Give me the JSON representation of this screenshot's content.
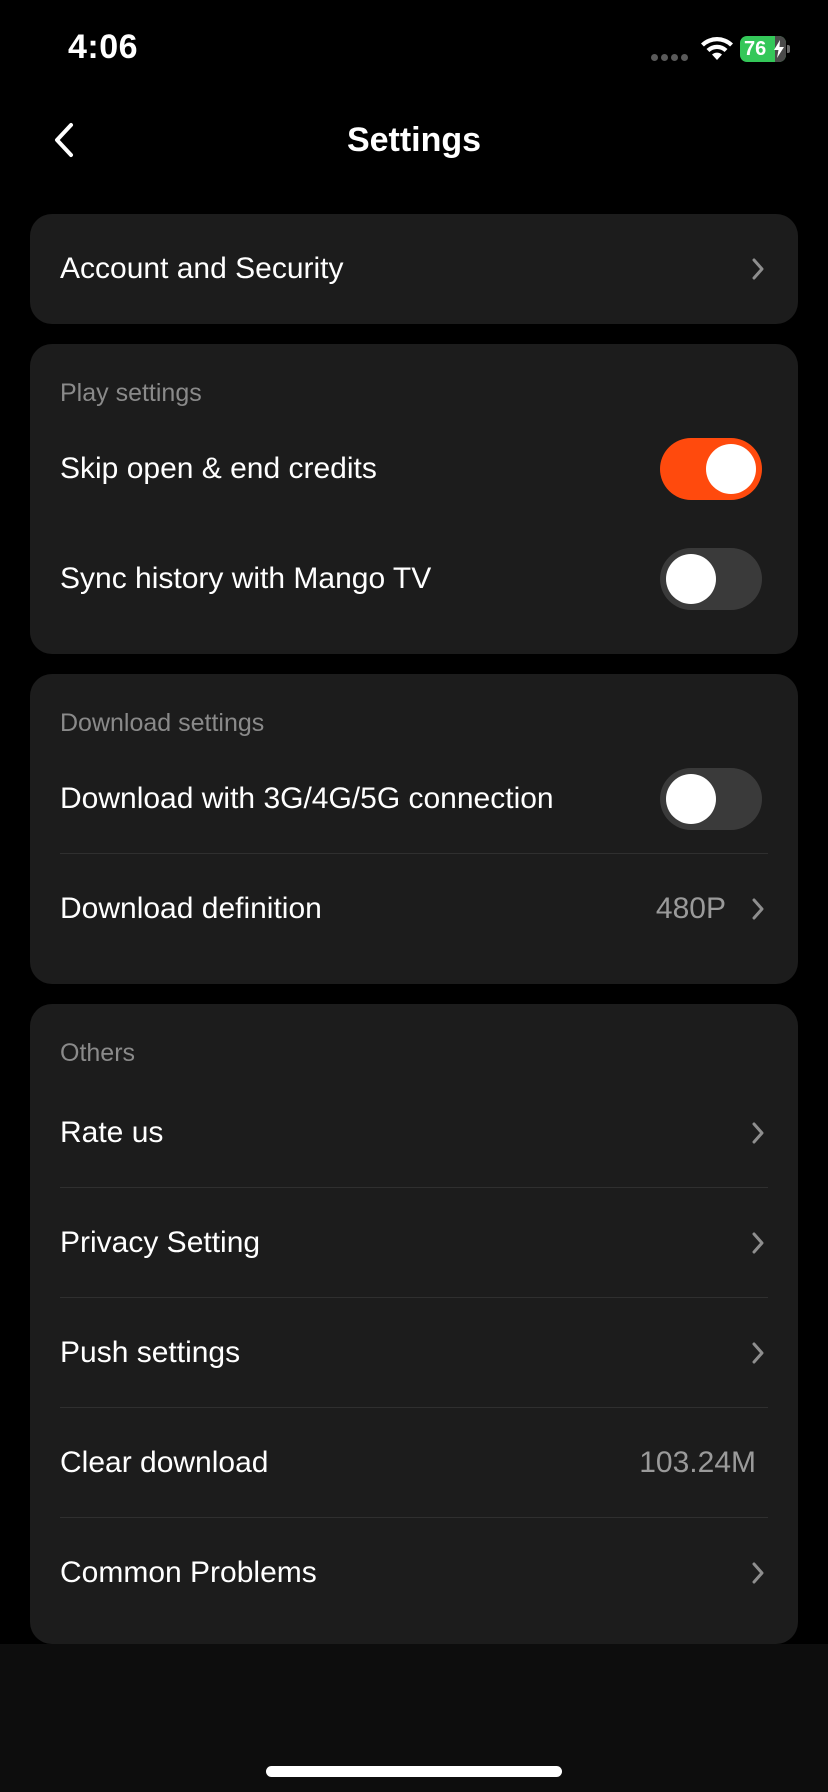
{
  "status_bar": {
    "time": "4:06",
    "battery_level": "76",
    "battery_color": "#34c759"
  },
  "nav": {
    "title": "Settings",
    "back_icon": "chevron-left-icon"
  },
  "account": {
    "label": "Account and Security"
  },
  "play_settings": {
    "section_label": "Play settings",
    "skip_credits": {
      "label": "Skip open & end credits",
      "enabled": true
    },
    "sync_history": {
      "label": "Sync history with Mango TV",
      "enabled": false
    }
  },
  "download_settings": {
    "section_label": "Download settings",
    "cellular": {
      "label": "Download with 3G/4G/5G connection",
      "enabled": false
    },
    "definition": {
      "label": "Download definition",
      "value": "480P"
    }
  },
  "others": {
    "section_label": "Others",
    "rate_us": {
      "label": "Rate us"
    },
    "privacy": {
      "label": "Privacy Setting"
    },
    "push": {
      "label": "Push settings"
    },
    "clear_download": {
      "label": "Clear download",
      "value": "103.24M"
    },
    "common_problems": {
      "label": "Common Problems"
    }
  },
  "colors": {
    "accent": "#ff4a0d",
    "card_background": "#1c1c1c",
    "page_background": "#000000"
  }
}
